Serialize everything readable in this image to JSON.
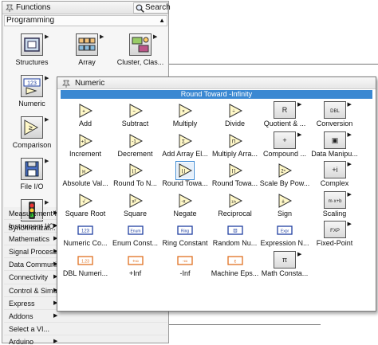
{
  "functions": {
    "title": "Functions",
    "search_label": "Search",
    "category": "Programming",
    "programming_items": [
      {
        "label": "Structures",
        "icon": "structures-icon"
      },
      {
        "label": "Array",
        "icon": "array-icon"
      },
      {
        "label": "Cluster, Clas...",
        "icon": "cluster-icon"
      },
      {
        "label": "Numeric",
        "icon": "numeric-icon"
      },
      {
        "label": "Comparison",
        "icon": "comparison-icon"
      },
      {
        "label": "File I/O",
        "icon": "file-io-icon"
      },
      {
        "label": "Synchronizat...",
        "icon": "synchronization-icon"
      }
    ],
    "categories": [
      "Measurement I/O",
      "Instrument I/O",
      "Mathematics",
      "Signal Processing",
      "Data Communication",
      "Connectivity",
      "Control & Simulation",
      "Express",
      "Addons",
      "Select a VI...",
      "Arduino"
    ]
  },
  "numeric": {
    "title": "Numeric",
    "status": "Round Toward -Infinity",
    "items": [
      {
        "label": "Add",
        "icon": "add-icon",
        "glyph": "+"
      },
      {
        "label": "Subtract",
        "icon": "subtract-icon",
        "glyph": "−"
      },
      {
        "label": "Multiply",
        "icon": "multiply-icon",
        "glyph": "×"
      },
      {
        "label": "Divide",
        "icon": "divide-icon",
        "glyph": "÷"
      },
      {
        "label": "Quotient & ...",
        "icon": "quotient-remainder-icon",
        "glyph": "R"
      },
      {
        "label": "Conversion",
        "icon": "conversion-icon",
        "glyph": "DBL"
      },
      {
        "label": "Increment",
        "icon": "increment-icon",
        "glyph": "+1"
      },
      {
        "label": "Decrement",
        "icon": "decrement-icon",
        "glyph": "-1"
      },
      {
        "label": "Add Array El...",
        "icon": "add-array-elements-icon",
        "glyph": "Σ"
      },
      {
        "label": "Multiply Arra...",
        "icon": "multiply-array-elements-icon",
        "glyph": "Π"
      },
      {
        "label": "Compound ...",
        "icon": "compound-arithmetic-icon",
        "glyph": "+"
      },
      {
        "label": "Data Manipu...",
        "icon": "data-manipulation-icon",
        "glyph": "▣"
      },
      {
        "label": "Absolute Val...",
        "icon": "absolute-value-icon",
        "glyph": "|x|"
      },
      {
        "label": "Round To N...",
        "icon": "round-to-nearest-icon",
        "glyph": "⌊⌉"
      },
      {
        "label": "Round Towa...",
        "icon": "round-toward-negative-infinity-icon",
        "glyph": "⌊⌋"
      },
      {
        "label": "Round Towa...",
        "icon": "round-toward-positive-infinity-icon",
        "glyph": "⌈⌉"
      },
      {
        "label": "Scale By Pow...",
        "icon": "scale-by-power-of-2-icon",
        "glyph": "2ⁿ"
      },
      {
        "label": "Complex",
        "icon": "complex-icon",
        "glyph": "+i"
      },
      {
        "label": "Square Root",
        "icon": "square-root-icon",
        "glyph": "√"
      },
      {
        "label": "Square",
        "icon": "square-icon",
        "glyph": "x²"
      },
      {
        "label": "Negate",
        "icon": "negate-icon",
        "glyph": "-x"
      },
      {
        "label": "Reciprocal",
        "icon": "reciprocal-icon",
        "glyph": "1/x"
      },
      {
        "label": "Sign",
        "icon": "sign-icon",
        "glyph": "±"
      },
      {
        "label": "Scaling",
        "icon": "scaling-icon",
        "glyph": "m·x+b"
      },
      {
        "label": "Numeric Co...",
        "icon": "numeric-constant-icon",
        "glyph": "123"
      },
      {
        "label": "Enum Const...",
        "icon": "enum-constant-icon",
        "glyph": "Enum"
      },
      {
        "label": "Ring Constant",
        "icon": "ring-constant-icon",
        "glyph": "Ring"
      },
      {
        "label": "Random Nu...",
        "icon": "random-number-icon",
        "glyph": "⚄"
      },
      {
        "label": "Expression N...",
        "icon": "expression-node-icon",
        "glyph": "Expr"
      },
      {
        "label": "Fixed-Point",
        "icon": "fixed-point-icon",
        "glyph": "FXP"
      },
      {
        "label": "DBL Numeri...",
        "icon": "dbl-numeric-constant-icon",
        "glyph": "1.23"
      },
      {
        "label": "+Inf",
        "icon": "positive-infinity-icon",
        "glyph": "+∞"
      },
      {
        "label": "-Inf",
        "icon": "negative-infinity-icon",
        "glyph": "-∞"
      },
      {
        "label": "Machine Eps...",
        "icon": "machine-epsilon-icon",
        "glyph": "ε"
      },
      {
        "label": "Math Consta...",
        "icon": "math-constants-icon",
        "glyph": "π"
      }
    ]
  },
  "colors": {
    "accent": "#3a88d2",
    "triangle_fill": "#fff8c8",
    "orange_constant": "#e07020",
    "blue_constant": "#1f3fa0"
  }
}
